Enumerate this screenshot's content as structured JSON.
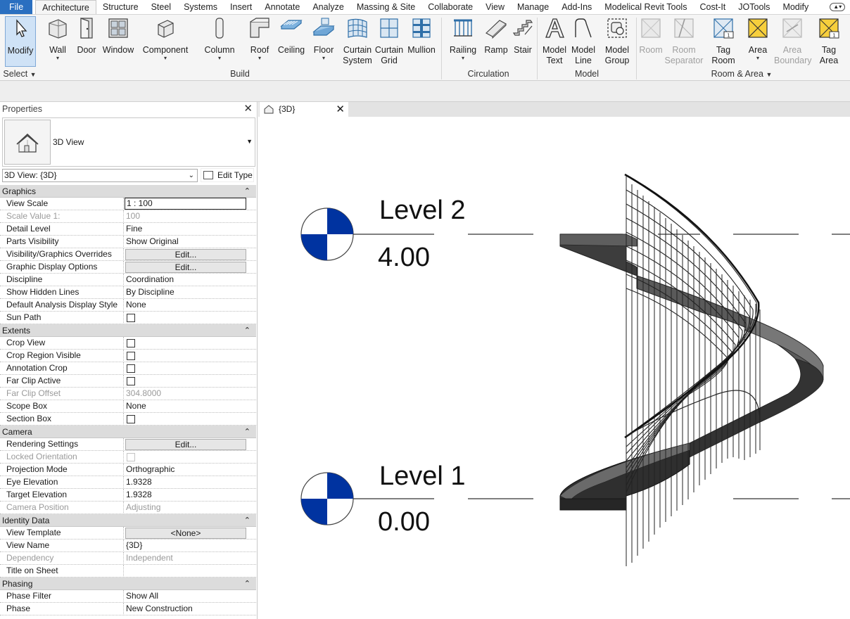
{
  "menu": {
    "tabs": [
      "File",
      "Architecture",
      "Structure",
      "Steel",
      "Systems",
      "Insert",
      "Annotate",
      "Analyze",
      "Massing & Site",
      "Collaborate",
      "View",
      "Manage",
      "Add-Ins",
      "Modelical Revit Tools",
      "Cost-It",
      "JOTools",
      "Modify"
    ],
    "active_tab": "Architecture"
  },
  "ribbon": {
    "tools": {
      "modify": "Modify",
      "wall": "Wall",
      "door": "Door",
      "window": "Window",
      "component": "Component",
      "column": "Column",
      "roof": "Roof",
      "ceiling": "Ceiling",
      "floor": "Floor",
      "curtain_system_1": "Curtain",
      "curtain_system_2": "System",
      "curtain_grid_1": "Curtain",
      "curtain_grid_2": "Grid",
      "mullion": "Mullion",
      "railing": "Railing",
      "ramp": "Ramp",
      "stair": "Stair",
      "model_text_1": "Model",
      "model_text_2": "Text",
      "model_line_1": "Model",
      "model_line_2": "Line",
      "model_group_1": "Model",
      "model_group_2": "Group",
      "room": "Room",
      "room_separator_1": "Room",
      "room_separator_2": "Separator",
      "tag_room_1": "Tag",
      "tag_room_2": "Room",
      "area": "Area",
      "area_boundary_1": "Area",
      "area_boundary_2": "Boundary",
      "tag_area_1": "Tag",
      "tag_area_2": "Area"
    },
    "groups": {
      "select": "Select",
      "build": "Build",
      "circulation": "Circulation",
      "model": "Model",
      "room_area": "Room & Area"
    }
  },
  "properties": {
    "title": "Properties",
    "type_name": "3D View",
    "instance_selector": "3D View: {3D}",
    "edit_type": "Edit Type",
    "categories": {
      "graphics": "Graphics",
      "extents": "Extents",
      "camera": "Camera",
      "identity": "Identity Data",
      "phasing": "Phasing"
    },
    "rows": {
      "view_scale": {
        "label": "View Scale",
        "value": "1 : 100"
      },
      "scale_value": {
        "label": "Scale Value    1:",
        "value": "100"
      },
      "detail_level": {
        "label": "Detail Level",
        "value": "Fine"
      },
      "parts_visibility": {
        "label": "Parts Visibility",
        "value": "Show Original"
      },
      "vg_overrides": {
        "label": "Visibility/Graphics Overrides",
        "value": "Edit..."
      },
      "graphic_display": {
        "label": "Graphic Display Options",
        "value": "Edit..."
      },
      "discipline": {
        "label": "Discipline",
        "value": "Coordination"
      },
      "hidden_lines": {
        "label": "Show Hidden Lines",
        "value": "By Discipline"
      },
      "analysis_style": {
        "label": "Default Analysis Display Style",
        "value": "None"
      },
      "sun_path": {
        "label": "Sun Path"
      },
      "crop_view": {
        "label": "Crop View"
      },
      "crop_visible": {
        "label": "Crop Region Visible"
      },
      "annotation_crop": {
        "label": "Annotation Crop"
      },
      "far_clip_active": {
        "label": "Far Clip Active"
      },
      "far_clip_offset": {
        "label": "Far Clip Offset",
        "value": "304.8000"
      },
      "scope_box": {
        "label": "Scope Box",
        "value": "None"
      },
      "section_box": {
        "label": "Section Box"
      },
      "rendering_settings": {
        "label": "Rendering Settings",
        "value": "Edit..."
      },
      "locked_orientation": {
        "label": "Locked Orientation"
      },
      "projection_mode": {
        "label": "Projection Mode",
        "value": "Orthographic"
      },
      "eye_elevation": {
        "label": "Eye Elevation",
        "value": "1.9328"
      },
      "target_elevation": {
        "label": "Target Elevation",
        "value": "1.9328"
      },
      "camera_position": {
        "label": "Camera Position",
        "value": "Adjusting"
      },
      "view_template": {
        "label": "View Template",
        "value": "<None>"
      },
      "view_name": {
        "label": "View Name",
        "value": "{3D}"
      },
      "dependency": {
        "label": "Dependency",
        "value": "Independent"
      },
      "title_on_sheet": {
        "label": "Title on Sheet",
        "value": ""
      },
      "phase_filter": {
        "label": "Phase Filter",
        "value": "Show All"
      },
      "phase": {
        "label": "Phase",
        "value": "New Construction"
      }
    }
  },
  "view": {
    "tab_label": "{3D}",
    "levels": {
      "level2": {
        "name": "Level 2",
        "elevation": "4.00"
      },
      "level1": {
        "name": "Level 1",
        "elevation": "0.00"
      }
    }
  },
  "colors": {
    "file_tab": "#2a6fc0",
    "level_head_blue": "#0033a0",
    "stair_dark": "#2b2b2b",
    "stair_side": "#5a5a5a"
  }
}
